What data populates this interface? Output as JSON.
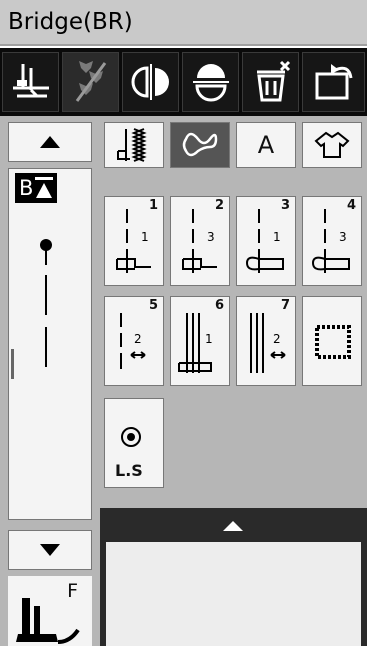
{
  "title": "Bridge(BR)",
  "toolbar": {
    "buttons": [
      {
        "icon": "presser-foot-needle-icon"
      },
      {
        "icon": "tie-off-icon"
      },
      {
        "icon": "mirror-horizontal-icon"
      },
      {
        "icon": "mirror-vertical-icon"
      },
      {
        "icon": "delete-icon"
      },
      {
        "icon": "return-icon"
      }
    ]
  },
  "categories": [
    {
      "icon": "utility-stitch-icon",
      "active": false
    },
    {
      "icon": "decorative-stitch-icon",
      "active": true
    },
    {
      "label": "A",
      "active": false
    },
    {
      "icon": "garment-icon",
      "active": false
    }
  ],
  "sequence": {
    "label": "B"
  },
  "stitches": [
    {
      "num": "1",
      "sub": "1"
    },
    {
      "num": "2",
      "sub": "3"
    },
    {
      "num": "3",
      "sub": "1"
    },
    {
      "num": "4",
      "sub": "3"
    },
    {
      "num": "5",
      "sub": "2"
    },
    {
      "num": "6",
      "sub": "1"
    },
    {
      "num": "7",
      "sub": "2"
    }
  ],
  "ls_label": "L.S",
  "foot": {
    "letter": "F"
  }
}
